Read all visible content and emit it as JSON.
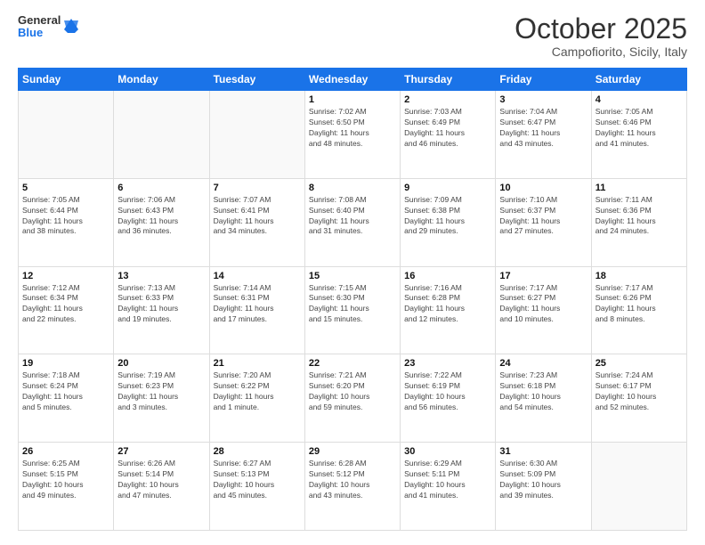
{
  "header": {
    "logo": {
      "general": "General",
      "blue": "Blue"
    },
    "title": "October 2025",
    "location": "Campofiorito, Sicily, Italy"
  },
  "weekdays": [
    "Sunday",
    "Monday",
    "Tuesday",
    "Wednesday",
    "Thursday",
    "Friday",
    "Saturday"
  ],
  "weeks": [
    [
      {
        "day": "",
        "info": ""
      },
      {
        "day": "",
        "info": ""
      },
      {
        "day": "",
        "info": ""
      },
      {
        "day": "1",
        "info": "Sunrise: 7:02 AM\nSunset: 6:50 PM\nDaylight: 11 hours\nand 48 minutes."
      },
      {
        "day": "2",
        "info": "Sunrise: 7:03 AM\nSunset: 6:49 PM\nDaylight: 11 hours\nand 46 minutes."
      },
      {
        "day": "3",
        "info": "Sunrise: 7:04 AM\nSunset: 6:47 PM\nDaylight: 11 hours\nand 43 minutes."
      },
      {
        "day": "4",
        "info": "Sunrise: 7:05 AM\nSunset: 6:46 PM\nDaylight: 11 hours\nand 41 minutes."
      }
    ],
    [
      {
        "day": "5",
        "info": "Sunrise: 7:05 AM\nSunset: 6:44 PM\nDaylight: 11 hours\nand 38 minutes."
      },
      {
        "day": "6",
        "info": "Sunrise: 7:06 AM\nSunset: 6:43 PM\nDaylight: 11 hours\nand 36 minutes."
      },
      {
        "day": "7",
        "info": "Sunrise: 7:07 AM\nSunset: 6:41 PM\nDaylight: 11 hours\nand 34 minutes."
      },
      {
        "day": "8",
        "info": "Sunrise: 7:08 AM\nSunset: 6:40 PM\nDaylight: 11 hours\nand 31 minutes."
      },
      {
        "day": "9",
        "info": "Sunrise: 7:09 AM\nSunset: 6:38 PM\nDaylight: 11 hours\nand 29 minutes."
      },
      {
        "day": "10",
        "info": "Sunrise: 7:10 AM\nSunset: 6:37 PM\nDaylight: 11 hours\nand 27 minutes."
      },
      {
        "day": "11",
        "info": "Sunrise: 7:11 AM\nSunset: 6:36 PM\nDaylight: 11 hours\nand 24 minutes."
      }
    ],
    [
      {
        "day": "12",
        "info": "Sunrise: 7:12 AM\nSunset: 6:34 PM\nDaylight: 11 hours\nand 22 minutes."
      },
      {
        "day": "13",
        "info": "Sunrise: 7:13 AM\nSunset: 6:33 PM\nDaylight: 11 hours\nand 19 minutes."
      },
      {
        "day": "14",
        "info": "Sunrise: 7:14 AM\nSunset: 6:31 PM\nDaylight: 11 hours\nand 17 minutes."
      },
      {
        "day": "15",
        "info": "Sunrise: 7:15 AM\nSunset: 6:30 PM\nDaylight: 11 hours\nand 15 minutes."
      },
      {
        "day": "16",
        "info": "Sunrise: 7:16 AM\nSunset: 6:28 PM\nDaylight: 11 hours\nand 12 minutes."
      },
      {
        "day": "17",
        "info": "Sunrise: 7:17 AM\nSunset: 6:27 PM\nDaylight: 11 hours\nand 10 minutes."
      },
      {
        "day": "18",
        "info": "Sunrise: 7:17 AM\nSunset: 6:26 PM\nDaylight: 11 hours\nand 8 minutes."
      }
    ],
    [
      {
        "day": "19",
        "info": "Sunrise: 7:18 AM\nSunset: 6:24 PM\nDaylight: 11 hours\nand 5 minutes."
      },
      {
        "day": "20",
        "info": "Sunrise: 7:19 AM\nSunset: 6:23 PM\nDaylight: 11 hours\nand 3 minutes."
      },
      {
        "day": "21",
        "info": "Sunrise: 7:20 AM\nSunset: 6:22 PM\nDaylight: 11 hours\nand 1 minute."
      },
      {
        "day": "22",
        "info": "Sunrise: 7:21 AM\nSunset: 6:20 PM\nDaylight: 10 hours\nand 59 minutes."
      },
      {
        "day": "23",
        "info": "Sunrise: 7:22 AM\nSunset: 6:19 PM\nDaylight: 10 hours\nand 56 minutes."
      },
      {
        "day": "24",
        "info": "Sunrise: 7:23 AM\nSunset: 6:18 PM\nDaylight: 10 hours\nand 54 minutes."
      },
      {
        "day": "25",
        "info": "Sunrise: 7:24 AM\nSunset: 6:17 PM\nDaylight: 10 hours\nand 52 minutes."
      }
    ],
    [
      {
        "day": "26",
        "info": "Sunrise: 6:25 AM\nSunset: 5:15 PM\nDaylight: 10 hours\nand 49 minutes."
      },
      {
        "day": "27",
        "info": "Sunrise: 6:26 AM\nSunset: 5:14 PM\nDaylight: 10 hours\nand 47 minutes."
      },
      {
        "day": "28",
        "info": "Sunrise: 6:27 AM\nSunset: 5:13 PM\nDaylight: 10 hours\nand 45 minutes."
      },
      {
        "day": "29",
        "info": "Sunrise: 6:28 AM\nSunset: 5:12 PM\nDaylight: 10 hours\nand 43 minutes."
      },
      {
        "day": "30",
        "info": "Sunrise: 6:29 AM\nSunset: 5:11 PM\nDaylight: 10 hours\nand 41 minutes."
      },
      {
        "day": "31",
        "info": "Sunrise: 6:30 AM\nSunset: 5:09 PM\nDaylight: 10 hours\nand 39 minutes."
      },
      {
        "day": "",
        "info": ""
      }
    ]
  ]
}
